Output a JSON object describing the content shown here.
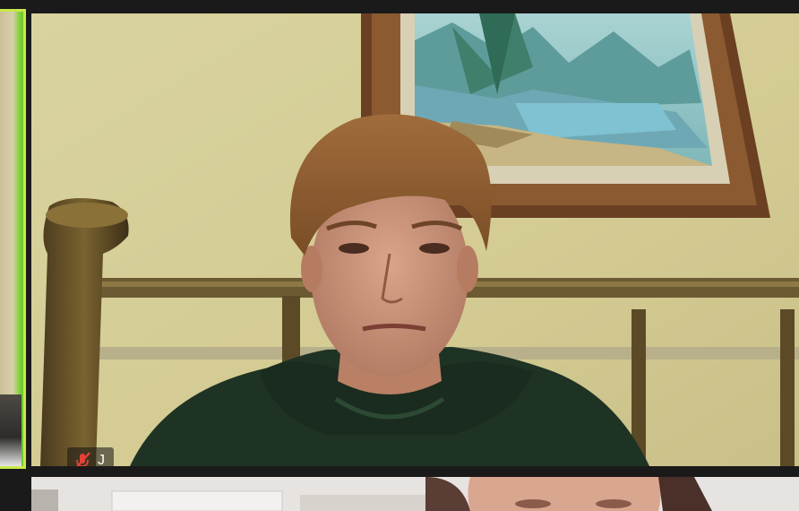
{
  "meeting": {
    "active_participant": {
      "initial": "J",
      "mic_state": "muted",
      "mic_icon": "mic-muted-icon"
    }
  },
  "colors": {
    "background": "#1a1a1a",
    "active_speaker_border": "#c9e84a",
    "muted_icon": "#e8413a"
  }
}
